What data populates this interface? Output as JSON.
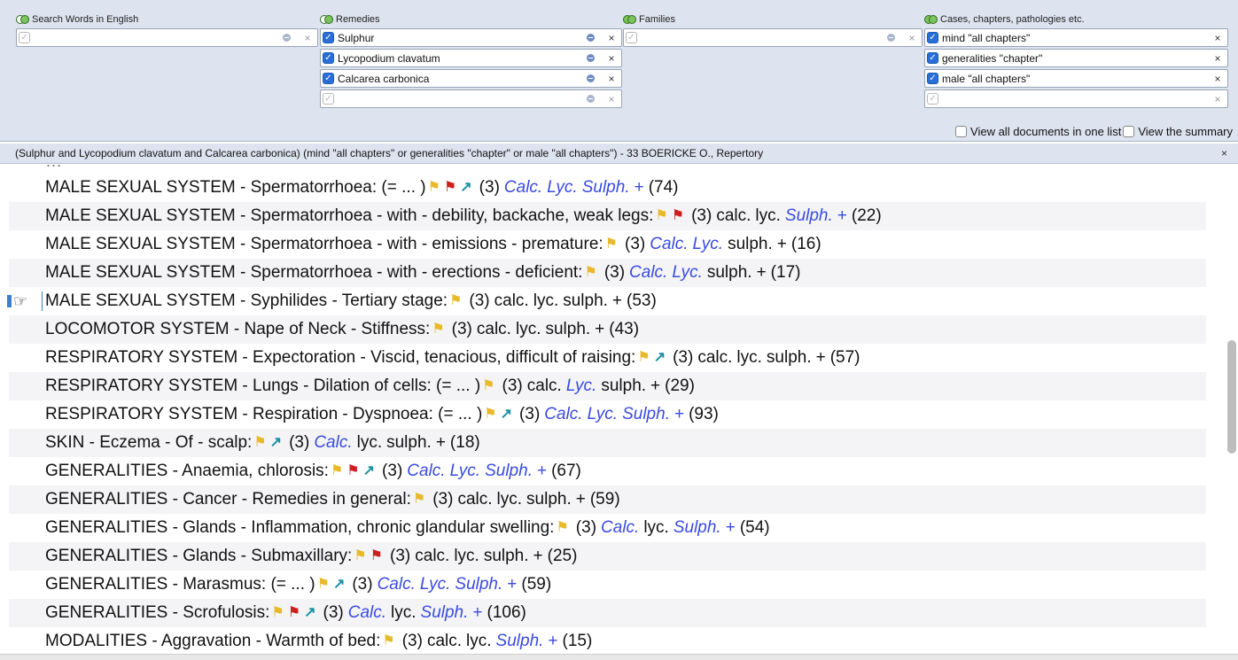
{
  "columns": [
    {
      "title": "Search Words in English",
      "icon": "empty-circles-icon",
      "fields": [
        {
          "checked": false,
          "text": "",
          "dim": true
        }
      ]
    },
    {
      "title": "Remedies",
      "icon": "empty-circles-icon",
      "fields": [
        {
          "checked": true,
          "text": "Sulphur",
          "dim": false
        },
        {
          "checked": true,
          "text": "Lycopodium clavatum",
          "dim": false
        },
        {
          "checked": true,
          "text": "Calcarea carbonica",
          "dim": false
        },
        {
          "checked": false,
          "text": "",
          "dim": true
        }
      ]
    },
    {
      "title": "Families",
      "icon": "full-circles-icon",
      "fields": [
        {
          "checked": false,
          "text": "",
          "dim": true
        }
      ]
    },
    {
      "title": "Cases, chapters, pathologies etc.",
      "icon": "full-circles-icon",
      "fields": [
        {
          "checked": true,
          "text": "mind \"all chapters\"",
          "dim": false
        },
        {
          "checked": true,
          "text": "generalities \"chapter\"",
          "dim": false
        },
        {
          "checked": true,
          "text": "male \"all chapters\"",
          "dim": false
        },
        {
          "checked": false,
          "text": "",
          "dim": true
        }
      ]
    }
  ],
  "options": {
    "view_all_label": "View all documents in one list",
    "view_summary_label": "View the summary"
  },
  "query": {
    "text": "(Sulphur and Lycopodium clavatum and Calcarea carbonica) (mind \"all chapters\" or generalities \"chapter\" or male \"all chapters\") - 33 BOERICKE O., Repertory",
    "close": "×"
  },
  "results": {
    "partial_top": "…",
    "rows": [
      {
        "rubric": "MALE SEXUAL SYSTEM - Spermatorrhoea: (= ... )",
        "icons": [
          "yellow",
          "red",
          "arrow"
        ],
        "count": "(3)",
        "calc": {
          "t": "Calc.",
          "hl": true
        },
        "lyc": {
          "t": "Lyc.",
          "hl": true
        },
        "sulph": {
          "t": "Sulph.",
          "hl": true
        },
        "plus_hl": true,
        "total": "(74)"
      },
      {
        "rubric": "MALE SEXUAL SYSTEM - Spermatorrhoea - with - debility, backache, weak legs:",
        "icons": [
          "yellow",
          "red"
        ],
        "count": "(3)",
        "calc": {
          "t": "calc.",
          "hl": false
        },
        "lyc": {
          "t": "lyc.",
          "hl": false
        },
        "sulph": {
          "t": "Sulph.",
          "hl": true
        },
        "plus_hl": true,
        "total": "(22)"
      },
      {
        "rubric": "MALE SEXUAL SYSTEM - Spermatorrhoea - with - emissions - premature:",
        "icons": [
          "yellow"
        ],
        "count": "(3)",
        "calc": {
          "t": "Calc.",
          "hl": true
        },
        "lyc": {
          "t": "Lyc.",
          "hl": true
        },
        "sulph": {
          "t": "sulph.",
          "hl": false
        },
        "plus_hl": false,
        "total": "(16)"
      },
      {
        "rubric": "MALE SEXUAL SYSTEM - Spermatorrhoea - with - erections - deficient:",
        "icons": [
          "yellow"
        ],
        "count": "(3)",
        "calc": {
          "t": "Calc.",
          "hl": true
        },
        "lyc": {
          "t": "Lyc.",
          "hl": true
        },
        "sulph": {
          "t": "sulph.",
          "hl": false
        },
        "plus_hl": false,
        "total": "(17)"
      },
      {
        "rubric": "MALE SEXUAL SYSTEM - Syphilides - Tertiary stage:",
        "icons": [
          "yellow"
        ],
        "count": "(3)",
        "calc": {
          "t": "calc.",
          "hl": false
        },
        "lyc": {
          "t": "lyc.",
          "hl": false
        },
        "sulph": {
          "t": "sulph.",
          "hl": false
        },
        "plus_hl": false,
        "total": "(53)",
        "pointer": true
      },
      {
        "rubric": "LOCOMOTOR SYSTEM - Nape of Neck - Stiffness:",
        "icons": [
          "yellow"
        ],
        "count": "(3)",
        "calc": {
          "t": "calc.",
          "hl": false
        },
        "lyc": {
          "t": "lyc.",
          "hl": false
        },
        "sulph": {
          "t": "sulph.",
          "hl": false
        },
        "plus_hl": false,
        "total": "(43)"
      },
      {
        "rubric": "RESPIRATORY SYSTEM - Expectoration - Viscid, tenacious, difficult of raising:",
        "icons": [
          "yellow",
          "arrow"
        ],
        "count": "(3)",
        "calc": {
          "t": "calc.",
          "hl": false
        },
        "lyc": {
          "t": "lyc.",
          "hl": false
        },
        "sulph": {
          "t": "sulph.",
          "hl": false
        },
        "plus_hl": false,
        "total": "(57)"
      },
      {
        "rubric": "RESPIRATORY SYSTEM - Lungs - Dilation of cells: (= ... )",
        "icons": [
          "yellow"
        ],
        "count": "(3)",
        "calc": {
          "t": "calc.",
          "hl": false
        },
        "lyc": {
          "t": "Lyc.",
          "hl": true
        },
        "sulph": {
          "t": "sulph.",
          "hl": false
        },
        "plus_hl": false,
        "total": "(29)"
      },
      {
        "rubric": "RESPIRATORY SYSTEM - Respiration - Dyspnoea: (= ... )",
        "icons": [
          "yellow",
          "arrow"
        ],
        "count": "(3)",
        "calc": {
          "t": "Calc.",
          "hl": true
        },
        "lyc": {
          "t": "Lyc.",
          "hl": true
        },
        "sulph": {
          "t": "Sulph.",
          "hl": true
        },
        "plus_hl": true,
        "total": "(93)"
      },
      {
        "rubric": "SKIN - Eczema - Of - scalp:",
        "icons": [
          "yellow",
          "arrow"
        ],
        "count": "(3)",
        "calc": {
          "t": "Calc.",
          "hl": true
        },
        "lyc": {
          "t": "lyc.",
          "hl": false
        },
        "sulph": {
          "t": "sulph.",
          "hl": false
        },
        "plus_hl": false,
        "total": "(18)"
      },
      {
        "rubric": "GENERALITIES - Anaemia, chlorosis:",
        "icons": [
          "yellow",
          "red",
          "arrow"
        ],
        "count": "(3)",
        "calc": {
          "t": "Calc.",
          "hl": true
        },
        "lyc": {
          "t": "Lyc.",
          "hl": true
        },
        "sulph": {
          "t": "Sulph.",
          "hl": true
        },
        "plus_hl": true,
        "total": "(67)"
      },
      {
        "rubric": "GENERALITIES - Cancer - Remedies in general:",
        "icons": [
          "yellow"
        ],
        "count": "(3)",
        "calc": {
          "t": "calc.",
          "hl": false
        },
        "lyc": {
          "t": "lyc.",
          "hl": false
        },
        "sulph": {
          "t": "sulph.",
          "hl": false
        },
        "plus_hl": false,
        "total": "(59)"
      },
      {
        "rubric": "GENERALITIES - Glands - Inflammation, chronic glandular swelling:",
        "icons": [
          "yellow"
        ],
        "count": "(3)",
        "calc": {
          "t": "Calc.",
          "hl": true
        },
        "lyc": {
          "t": "lyc.",
          "hl": false
        },
        "sulph": {
          "t": "Sulph.",
          "hl": true
        },
        "plus_hl": true,
        "total": "(54)"
      },
      {
        "rubric": "GENERALITIES - Glands - Submaxillary:",
        "icons": [
          "yellow",
          "red"
        ],
        "count": "(3)",
        "calc": {
          "t": "calc.",
          "hl": false
        },
        "lyc": {
          "t": "lyc.",
          "hl": false
        },
        "sulph": {
          "t": "sulph.",
          "hl": false
        },
        "plus_hl": false,
        "total": "(25)"
      },
      {
        "rubric": "GENERALITIES - Marasmus: (= ... )",
        "icons": [
          "yellow",
          "arrow"
        ],
        "count": "(3)",
        "calc": {
          "t": "Calc.",
          "hl": true
        },
        "lyc": {
          "t": "Lyc.",
          "hl": true
        },
        "sulph": {
          "t": "Sulph.",
          "hl": true
        },
        "plus_hl": true,
        "total": "(59)"
      },
      {
        "rubric": "GENERALITIES - Scrofulosis:",
        "icons": [
          "yellow",
          "red",
          "arrow"
        ],
        "count": "(3)",
        "calc": {
          "t": "Calc.",
          "hl": true
        },
        "lyc": {
          "t": "lyc.",
          "hl": false
        },
        "sulph": {
          "t": "Sulph.",
          "hl": true
        },
        "plus_hl": true,
        "total": "(106)"
      },
      {
        "rubric": "MODALITIES - Aggravation - Warmth of bed:",
        "icons": [
          "yellow"
        ],
        "count": "(3)",
        "calc": {
          "t": "calc.",
          "hl": false
        },
        "lyc": {
          "t": "lyc.",
          "hl": false
        },
        "sulph": {
          "t": "Sulph.",
          "hl": true
        },
        "plus_hl": true,
        "total": "(15)"
      }
    ]
  },
  "glyphs": {
    "yellow": "⚑",
    "red": "⚑",
    "arrow": "↗",
    "plus": "+",
    "check": "✓",
    "close": "×",
    "hand": "☞"
  },
  "colors": {
    "accent": "#3a4be0",
    "flag_yellow": "#e8b92b",
    "flag_red": "#cc1f1f",
    "arrow": "#1a8fa3",
    "panel": "#dde3ef"
  }
}
